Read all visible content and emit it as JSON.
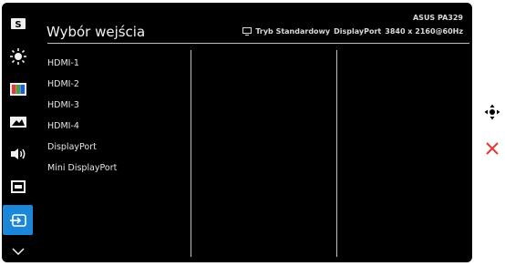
{
  "header": {
    "title": "Wybór wejścia",
    "model": "ASUS PA329",
    "mode": "Tryb Standardowy",
    "input": "DisplayPort",
    "resolution": "3840 x 2160@60Hz"
  },
  "sidebar": {
    "items": [
      {
        "icon": "splendid-s-icon",
        "label": "S"
      },
      {
        "icon": "brightness-icon"
      },
      {
        "icon": "color-icon"
      },
      {
        "icon": "image-icon"
      },
      {
        "icon": "sound-icon"
      },
      {
        "icon": "pip-icon"
      },
      {
        "icon": "input-select-icon",
        "active": true
      },
      {
        "icon": "chevron-down-icon"
      }
    ]
  },
  "input_options": [
    "HDMI-1",
    "HDMI-2",
    "HDMI-3",
    "HDMI-4",
    "DisplayPort",
    "Mini DisplayPort"
  ],
  "right_controls": [
    {
      "icon": "navigation-joystick-icon"
    },
    {
      "icon": "close-x-icon"
    }
  ],
  "colors": {
    "background": "#000000",
    "accent": "#1c86d9",
    "close": "#e53935",
    "text": "#e6e6e6"
  }
}
